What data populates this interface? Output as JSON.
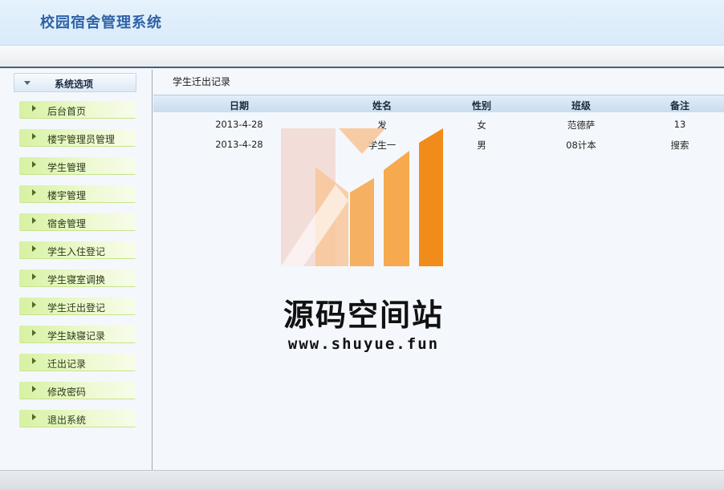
{
  "app": {
    "title": "校园宿舍管理系统"
  },
  "sidebar": {
    "header": "系统选项",
    "items": [
      {
        "label": "后台首页"
      },
      {
        "label": "楼宇管理员管理"
      },
      {
        "label": "学生管理"
      },
      {
        "label": "楼宇管理"
      },
      {
        "label": "宿舍管理"
      },
      {
        "label": "学生入住登记"
      },
      {
        "label": "学生寝室调换"
      },
      {
        "label": "学生迁出登记"
      },
      {
        "label": "学生缺寝记录"
      },
      {
        "label": "迁出记录"
      },
      {
        "label": "修改密码"
      },
      {
        "label": "退出系统"
      }
    ]
  },
  "main": {
    "title": "学生迁出记录",
    "columns": [
      "日期",
      "姓名",
      "性别",
      "班级",
      "备注"
    ],
    "rows": [
      [
        "2013-4-28",
        "发",
        "女",
        "范德萨",
        "13"
      ],
      [
        "2013-4-28",
        "学生一",
        "男",
        "08计本",
        "搜索"
      ]
    ]
  },
  "watermark": {
    "name": "源码空间站",
    "url": "www.shuyue.fun",
    "colors": {
      "light": "#f2d8d2",
      "peach": "#f7c79a",
      "orange": "#f5a445",
      "deep": "#f0860f"
    }
  }
}
